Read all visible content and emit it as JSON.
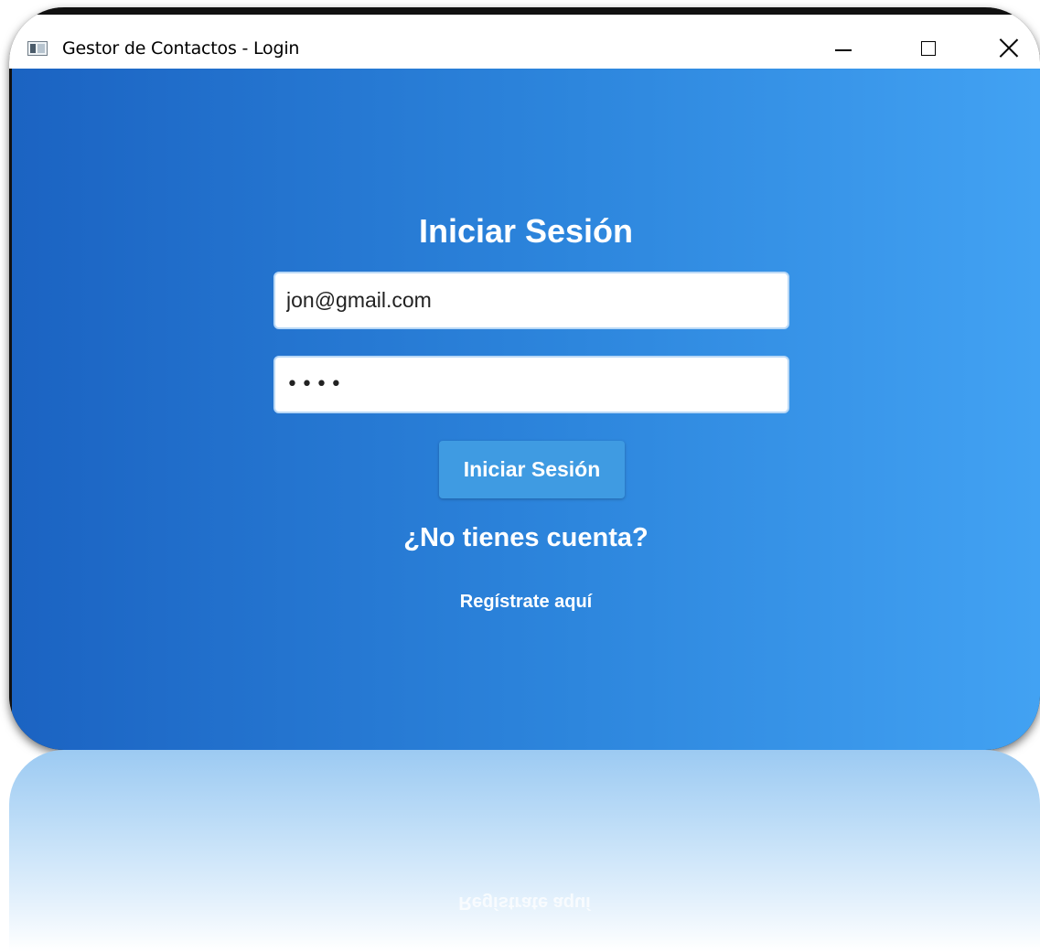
{
  "window": {
    "title": "Gestor de Contactos - Login",
    "controls": [
      "minimize-icon",
      "maximize-icon",
      "close-icon"
    ]
  },
  "login": {
    "heading": "Iniciar Sesión",
    "email_value": "jon@gmail.com",
    "password_value": "aaaa",
    "submit_label": "Iniciar Sesión",
    "no_account_text": "¿No tienes cuenta?",
    "register_link": "Regístrate aquí"
  },
  "colors": {
    "gradient_start": "#1b63c2",
    "gradient_end": "#42a2f3",
    "button": "#3f9be2"
  }
}
